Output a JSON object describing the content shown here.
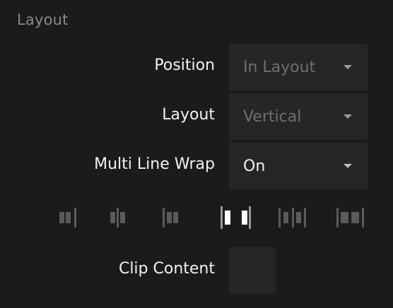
{
  "section": {
    "title": "Layout"
  },
  "position": {
    "label": "Position",
    "value": "In Layout"
  },
  "layout": {
    "label": "Layout",
    "value": "Vertical"
  },
  "wrap": {
    "label": "Multi Line Wrap",
    "value": "On"
  },
  "alignment": {
    "options": [
      "align-start-icon",
      "align-center-icon",
      "align-end-icon",
      "space-between-icon",
      "space-around-icon",
      "space-evenly-icon"
    ],
    "selected_index": 3
  },
  "clip": {
    "label": "Clip Content",
    "checked": false
  },
  "colors": {
    "background": "#1b1b1b",
    "field": "#262626",
    "label": "#f2f2f2",
    "dim_text": "#6f6f6f",
    "icon_inactive": "#5a5a5a",
    "icon_selected": "#ffffff"
  }
}
